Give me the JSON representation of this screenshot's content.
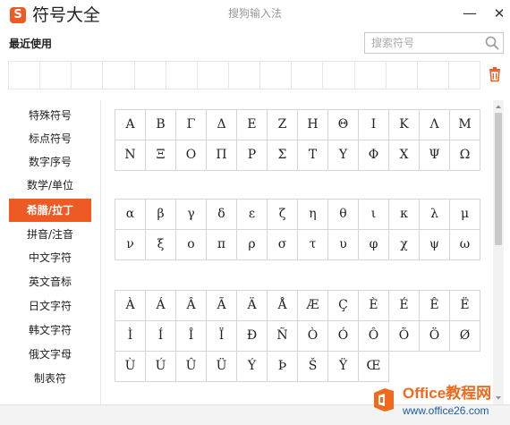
{
  "window": {
    "logo_letter": "S",
    "title": "符号大全",
    "center_title": "搜狗输入法",
    "minimize_glyph": "—",
    "close_glyph": "✕"
  },
  "recent": {
    "label": "最近使用",
    "slots": [
      "",
      "",
      "",
      "",
      "",
      "",
      "",
      "",
      "",
      "",
      "",
      "",
      "",
      "",
      ""
    ]
  },
  "search": {
    "placeholder": "搜索符号",
    "value": ""
  },
  "sidebar": {
    "items": [
      {
        "label": "特殊符号",
        "active": false
      },
      {
        "label": "标点符号",
        "active": false
      },
      {
        "label": "数字序号",
        "active": false
      },
      {
        "label": "数学/单位",
        "active": false
      },
      {
        "label": "希腊/拉丁",
        "active": true
      },
      {
        "label": "拼音/注音",
        "active": false
      },
      {
        "label": "中文字符",
        "active": false
      },
      {
        "label": "英文音标",
        "active": false
      },
      {
        "label": "日文字符",
        "active": false
      },
      {
        "label": "韩文字符",
        "active": false
      },
      {
        "label": "俄文字母",
        "active": false
      },
      {
        "label": "制表符",
        "active": false
      }
    ]
  },
  "groups": [
    {
      "rows": [
        [
          "Α",
          "Β",
          "Γ",
          "Δ",
          "Ε",
          "Ζ",
          "Η",
          "Θ",
          "Ι",
          "Κ",
          "Λ",
          "Μ"
        ],
        [
          "Ν",
          "Ξ",
          "Ο",
          "Π",
          "Ρ",
          "Σ",
          "Τ",
          "Υ",
          "Φ",
          "Χ",
          "Ψ",
          "Ω"
        ]
      ]
    },
    {
      "rows": [
        [
          "α",
          "β",
          "γ",
          "δ",
          "ε",
          "ζ",
          "η",
          "θ",
          "ι",
          "κ",
          "λ",
          "μ"
        ],
        [
          "ν",
          "ξ",
          "ο",
          "π",
          "ρ",
          "σ",
          "τ",
          "υ",
          "φ",
          "χ",
          "ψ",
          "ω"
        ]
      ]
    },
    {
      "rows": [
        [
          "À",
          "Á",
          "Â",
          "Ã",
          "Ä",
          "Å",
          "Æ",
          "Ç",
          "È",
          "É",
          "Ê",
          "Ë"
        ],
        [
          "Ì",
          "Í",
          "Î",
          "Ï",
          "Ð",
          "Ñ",
          "Ò",
          "Ó",
          "Ô",
          "Õ",
          "Ö",
          "Ø"
        ],
        [
          "Ù",
          "Ú",
          "Û",
          "Ü",
          "Ý",
          "Þ",
          "Š",
          "Ÿ",
          "Œ"
        ]
      ]
    }
  ],
  "watermark": {
    "title": "Office教程网",
    "url": "www.office26.com"
  },
  "colors": {
    "accent": "#ee5a24",
    "grid_border": "#d5d5d5",
    "watermark_orange": "#f06a1d",
    "watermark_blue": "#1a5ea8"
  },
  "icons": {
    "search": "search-icon",
    "trash": "trash-icon",
    "close": "close-icon",
    "minimize": "minimize-icon"
  }
}
